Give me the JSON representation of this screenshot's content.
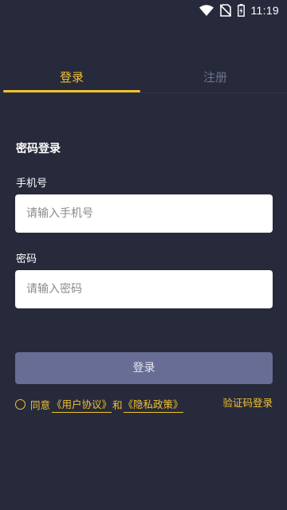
{
  "status_bar": {
    "time": "11:19",
    "icons": [
      "wifi-icon",
      "no-sim-icon",
      "battery-charging-icon"
    ]
  },
  "tabs": [
    {
      "label": "登录",
      "active": true
    },
    {
      "label": "注册",
      "active": false
    }
  ],
  "form": {
    "title": "密码登录",
    "phone_label": "手机号",
    "phone_placeholder": "请输入手机号",
    "password_label": "密码",
    "password_placeholder": "请输入密码",
    "submit_label": "登录"
  },
  "agreement": {
    "prefix": "同意",
    "user_agreement": "《用户协议》",
    "and": "和",
    "privacy_policy": "《隐私政策》"
  },
  "sms_login_label": "验证码登录",
  "colors": {
    "background": "#272a3a",
    "accent": "#f2c230",
    "button": "#676d94",
    "inactive_tab": "#6f7392"
  }
}
